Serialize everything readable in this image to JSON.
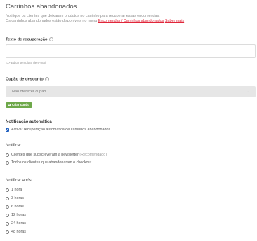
{
  "page": {
    "title": "Carrinhos abandonados",
    "desc_line1": "Notifique os clientes que deixaram produtos no carrinho para recuperar essas encomendas.",
    "desc_line2_prefix": "Os carrinhos abandonados estão disponíveis no menu ",
    "desc_link1": "Encomendas / Carrinhos abandonados",
    "desc_link2": "Saber mais"
  },
  "recovery": {
    "label": "Texto de recuperação",
    "value": "",
    "edit_template": "</> Editar template de e-mail"
  },
  "discount": {
    "label": "Cupão de desconto",
    "selected": "Não oferecer cupão",
    "create_button": "Criar cupão"
  },
  "auto_notification": {
    "title": "Notificação automática",
    "checkbox_label": "Activar recuperação automática de carrinhos abandonados"
  },
  "notify": {
    "title": "Notificar",
    "options": [
      {
        "label": "Clientes que subscreveram a newsletter",
        "hint": "(Recomendado)"
      },
      {
        "label": "Todos os clientes que abandonaram o checkout",
        "hint": ""
      }
    ]
  },
  "notify_after": {
    "title": "Notificar após",
    "options": [
      "1 hora",
      "3 horas",
      "6 horas",
      "12 horas",
      "24 horas",
      "48 horas"
    ]
  },
  "colors": {
    "link": "#e0263a",
    "checkbox": "#1f5fbf",
    "button_green": "#6ea84a"
  }
}
